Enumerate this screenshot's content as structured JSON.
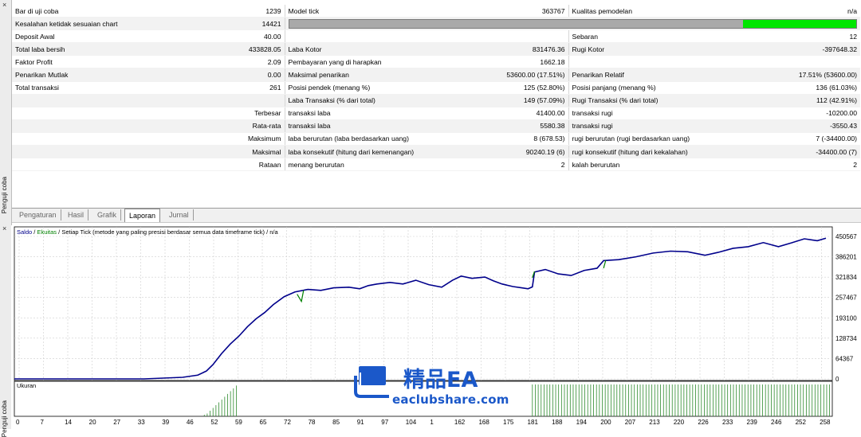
{
  "side_panel": {
    "close_glyph": "×",
    "label": "Penguji coba"
  },
  "report_rows": [
    [
      "Bar di uji coba",
      "1239",
      "Model tick",
      "363767",
      "Kualitas pemodelan",
      "n/a"
    ],
    [
      "Kesalahan ketidak sesuaian chart",
      "14421",
      "",
      "",
      "",
      ""
    ],
    [
      "Deposit Awal",
      "40.00",
      "",
      "",
      "Sebaran",
      "12"
    ],
    [
      "Total laba bersih",
      "433828.05",
      "Laba Kotor",
      "831476.36",
      "Rugi Kotor",
      "-397648.32"
    ],
    [
      "Faktor Profit",
      "2.09",
      "Pembayaran yang di harapkan",
      "1662.18",
      "",
      ""
    ],
    [
      "Penarikan Mutlak",
      "0.00",
      "Maksimal penarikan",
      "53600.00 (17.51%)",
      "Penarikan Relatif",
      "17.51% (53600.00)"
    ],
    [
      "Total transaksi",
      "261",
      "Posisi pendek (menang %)",
      "125 (52.80%)",
      "Posisi panjang (menang %)",
      "136 (61.03%)"
    ],
    [
      "",
      "",
      "Laba Transaksi (% dari total)",
      "149 (57.09%)",
      "Rugi Transaksi (% dari total)",
      "112 (42.91%)"
    ],
    [
      "",
      "Terbesar",
      "transaksi laba",
      "41400.00",
      "transaksi rugi",
      "-10200.00"
    ],
    [
      "",
      "Rata-rata",
      "transaksi laba",
      "5580.38",
      "transaksi rugi",
      "-3550.43"
    ],
    [
      "",
      "Maksimum",
      "laba berurutan (laba berdasarkan uang)",
      "8 (678.53)",
      "rugi berurutan (rugi berdasarkan uang)",
      "7 (-34400.00)"
    ],
    [
      "",
      "Maksimal",
      "laba konsekutif (hitung dari kemenangan)",
      "90240.19 (6)",
      "rugi konsekutif (hitung dari kekalahan)",
      "-34400.00 (7)"
    ],
    [
      "",
      "Rataan",
      "menang berurutan",
      "2",
      "kalah berurutan",
      "2"
    ]
  ],
  "modeling_quality": {
    "bar_fill": 0.2,
    "colors": {
      "bar": "#a9a9a9",
      "fill": "#00e600"
    }
  },
  "tabs": [
    "Pengaturan",
    "Hasil",
    "Grafik",
    "Laporan",
    "Jurnal"
  ],
  "active_tab": "Laporan",
  "chart_data": {
    "type": "line",
    "legend": {
      "balance": "Saldo",
      "sep1": " / ",
      "equity": "Ekuitas",
      "rest": " / Setiap Tick (metode yang paling presisi berdasar semua data timeframe tick) / n/a"
    },
    "colors": {
      "balance": "#00008b",
      "equity": "#008000",
      "volume": "#2e8b2e"
    },
    "y_ticks": [
      0,
      64367,
      128734,
      193100,
      257467,
      321834,
      386201,
      450567
    ],
    "ylim": [
      0,
      450567
    ],
    "xlim": [
      0,
      262
    ],
    "x_ticks": [
      "0",
      "7",
      "14",
      "20",
      "27",
      "33",
      "39",
      "46",
      "52",
      "59",
      "65",
      "72",
      "78",
      "85",
      "91",
      "97",
      "104",
      "1",
      "162",
      "168",
      "175",
      "181",
      "188",
      "194",
      "200",
      "207",
      "213",
      "220",
      "226",
      "233",
      "239",
      "246",
      "252",
      "258"
    ],
    "balance": [
      [
        0,
        0
      ],
      [
        60,
        0
      ],
      [
        78,
        5000
      ],
      [
        85,
        12000
      ],
      [
        89,
        25000
      ],
      [
        92,
        45000
      ],
      [
        96,
        80000
      ],
      [
        100,
        110000
      ],
      [
        104,
        135000
      ],
      [
        108,
        165000
      ],
      [
        112,
        190000
      ],
      [
        116,
        210000
      ],
      [
        120,
        235000
      ],
      [
        125,
        260000
      ],
      [
        130,
        275000
      ],
      [
        136,
        283000
      ],
      [
        142,
        280000
      ],
      [
        148,
        288000
      ],
      [
        155,
        290000
      ],
      [
        160,
        285000
      ],
      [
        164,
        295000
      ],
      [
        168,
        300000
      ],
      [
        174,
        305000
      ],
      [
        180,
        300000
      ],
      [
        186,
        312000
      ],
      [
        192,
        298000
      ],
      [
        198,
        290000
      ],
      [
        203,
        312000
      ],
      [
        207,
        325000
      ],
      [
        212,
        318000
      ],
      [
        218,
        322000
      ],
      [
        222,
        310000
      ],
      [
        226,
        300000
      ],
      [
        231,
        292000
      ],
      [
        235,
        288000
      ],
      [
        238,
        285000
      ],
      [
        240,
        291000
      ],
      [
        241,
        338000
      ],
      [
        246,
        346000
      ],
      [
        252,
        332000
      ],
      [
        258,
        327000
      ],
      [
        264,
        343000
      ],
      [
        270,
        350000
      ],
      [
        273,
        374000
      ],
      [
        280,
        377000
      ],
      [
        288,
        386000
      ],
      [
        296,
        398000
      ],
      [
        304,
        404000
      ],
      [
        312,
        402000
      ],
      [
        320,
        391000
      ],
      [
        326,
        400000
      ],
      [
        333,
        413000
      ],
      [
        340,
        418000
      ],
      [
        347,
        431000
      ],
      [
        354,
        418000
      ],
      [
        360,
        430000
      ],
      [
        366,
        443000
      ],
      [
        372,
        437000
      ],
      [
        376,
        445000
      ]
    ],
    "equity_dips": [
      [
        131,
        268000
      ],
      [
        133,
        245000
      ],
      [
        134,
        280000
      ],
      [
        240,
        320000
      ],
      [
        241,
        340000
      ],
      [
        273,
        350000
      ],
      [
        274,
        375000
      ]
    ],
    "volume_label": "Ukuran",
    "volume_segments": [
      [
        88,
        104
      ],
      [
        240,
        378
      ]
    ]
  },
  "watermark": {
    "title": "精品EA",
    "url": "eaclubshare.com"
  }
}
